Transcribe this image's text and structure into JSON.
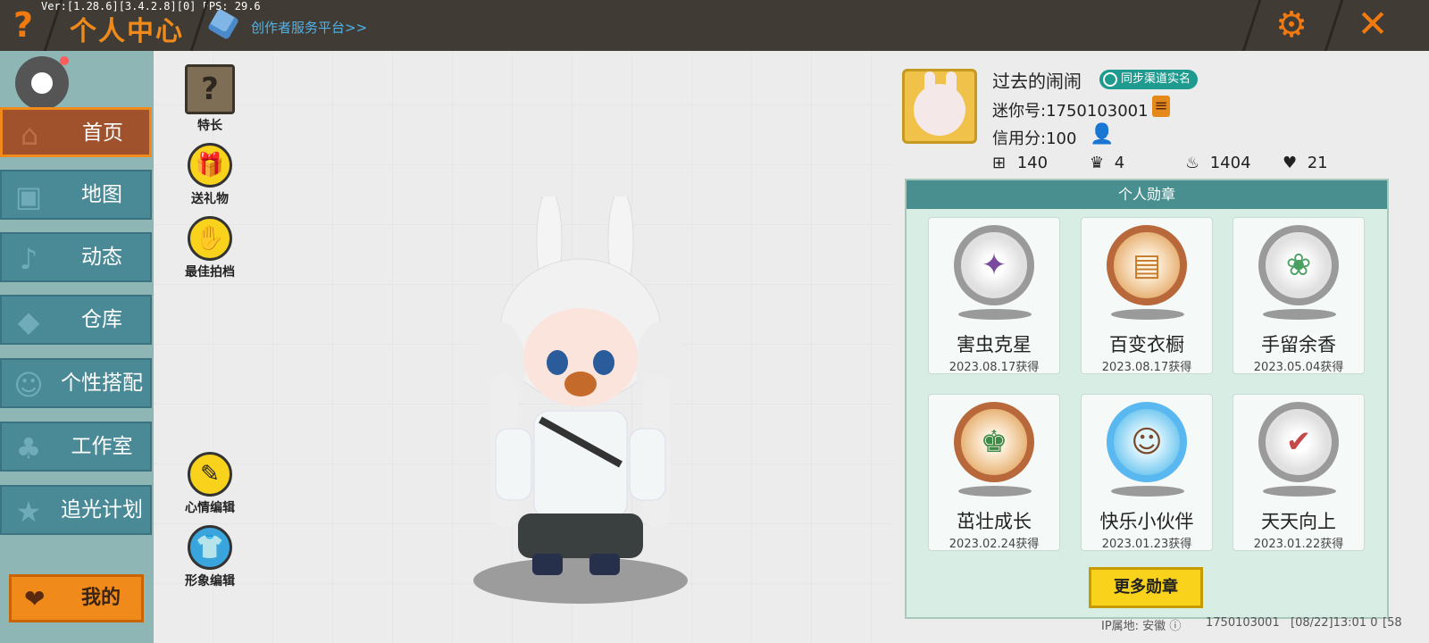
{
  "topbar": {
    "help_icon": "question-icon",
    "version": "Ver:[1.28.6][3.4.2.8][0] FPS: 29.6",
    "title": "个人中心",
    "creator_link": "创作者服务平台>>",
    "settings_icon": "gear-icon",
    "close_icon": "close-icon"
  },
  "sidebar": {
    "items": [
      {
        "label": "首页",
        "icon": "house-icon",
        "active": true
      },
      {
        "label": "地图",
        "icon": "picture-icon",
        "active": false
      },
      {
        "label": "动态",
        "icon": "bell-icon",
        "active": false
      },
      {
        "label": "仓库",
        "icon": "box-icon",
        "active": false
      },
      {
        "label": "个性搭配",
        "icon": "face-icon",
        "active": false
      },
      {
        "label": "工作室",
        "icon": "tree-icon",
        "active": false
      },
      {
        "label": "追光计划",
        "icon": "star-icon",
        "active": false
      }
    ],
    "mine_label": "我的"
  },
  "tools": {
    "skill": "特长",
    "gift": "送礼物",
    "best_partner": "最佳拍档",
    "mood_edit": "心情编辑",
    "avatar_edit": "形象编辑"
  },
  "profile": {
    "nickname": "过去的闹闹",
    "badge": "同步渠道实名",
    "mini_id": "迷你号:1750103001",
    "credit": "信用分:100",
    "stats": [
      {
        "icon": "plus-box-icon",
        "value": "140"
      },
      {
        "icon": "fans-icon",
        "value": "4"
      },
      {
        "icon": "fire-icon",
        "value": "1404"
      },
      {
        "icon": "hearts-icon",
        "value": "21"
      }
    ]
  },
  "medals": {
    "title": "个人勋章",
    "items": [
      {
        "name": "害虫克星",
        "date": "2023.08.17获得",
        "style": "silver"
      },
      {
        "name": "百变衣橱",
        "date": "2023.08.17获得",
        "style": "bronze"
      },
      {
        "name": "手留余香",
        "date": "2023.05.04获得",
        "style": "silver"
      },
      {
        "name": "茁壮成长",
        "date": "2023.02.24获得",
        "style": "bronze"
      },
      {
        "name": "快乐小伙伴",
        "date": "2023.01.23获得",
        "style": "blue"
      },
      {
        "name": "天天向上",
        "date": "2023.01.22获得",
        "style": "silver"
      }
    ],
    "more_button": "更多勋章"
  },
  "footer": {
    "ip": "IP属地: 安徽",
    "uid": "1750103001",
    "time": "[08/22]13:01 0",
    "extra": "[58"
  },
  "colors": {
    "accent_orange": "#f08a1a",
    "sidebar_teal": "#4a8a97",
    "medal_header": "#4a8f90",
    "yellow_button": "#f9d21b"
  }
}
